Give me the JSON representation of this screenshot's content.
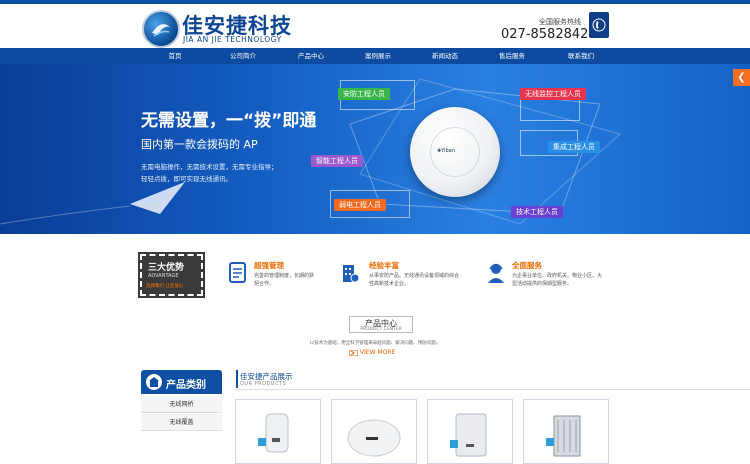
{
  "header": {
    "logo_cn": "佳安捷科技",
    "logo_en": "JIA AN JIE TECHNOLOGY",
    "hotline_label": "全国服务热线",
    "hotline_number": "027-85828421"
  },
  "nav": {
    "items": [
      "首页",
      "公司简介",
      "产品中心",
      "案例展示",
      "新闻动态",
      "售后服务",
      "联系我们"
    ]
  },
  "banner": {
    "title": "无需设置，一“拨”即通",
    "subtitle": "国内第一款会拨码的 AP",
    "desc_line1": "无需电脑操作，无需技术设置，无需专业指导；",
    "desc_line2": "轻轻点拨，即可实现无线通讯。",
    "ap_label": "✚Yiban",
    "tags": [
      {
        "label": "安防工程人员",
        "color": "#3ab54a"
      },
      {
        "label": "无线监控工程人员",
        "color": "#e8344e"
      },
      {
        "label": "智能工程人员",
        "color": "#9b59d0"
      },
      {
        "label": "集成工程人员",
        "color": "#2b8fe6"
      },
      {
        "label": "弱电工程人员",
        "color": "#f26a21"
      },
      {
        "label": "技术工程人员",
        "color": "#6a3fd4"
      }
    ]
  },
  "advantages": {
    "box_title": "三大优势",
    "box_en": "ADVANTAGE",
    "box_sub": "选择我们 让您放心",
    "items": [
      {
        "title": "超强管理",
        "desc": "完善的管理制度，长期的默契合作。",
        "icon": "document-icon"
      },
      {
        "title": "经验丰富",
        "desc": "从事安防产品、无线通讯设备领域的综合性高新技术企业。",
        "icon": "building-icon"
      },
      {
        "title": "全面服务",
        "desc": "为企事业单位、政府机关、物业小区、大型活动提供的保姆型服务。",
        "icon": "support-agent-icon"
      }
    ]
  },
  "product_center": {
    "title_cn": "产品中心",
    "title_en": "PRODUCT CENTER",
    "desc": "以技术为基础，用全科学管理来卓越问题、解决问题、预防问题。",
    "view_more": "VIEW MORE"
  },
  "categories": {
    "title": "产品类别",
    "items": [
      "无线网桥",
      "无线覆盖"
    ]
  },
  "products": {
    "title_cn": "佳安捷产品展示",
    "title_en": "OUR  PRODUCTS"
  },
  "colors": {
    "primary": "#0d4fa3",
    "accent": "#f06a00"
  }
}
